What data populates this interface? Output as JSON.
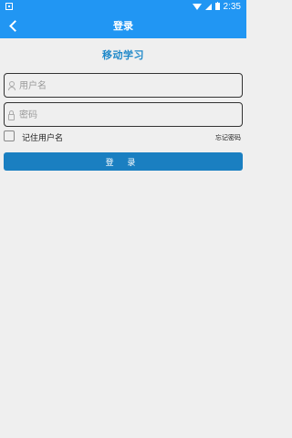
{
  "status_bar": {
    "time": "2:35",
    "icons": [
      "notification-icon",
      "wifi-icon",
      "signal-icon",
      "battery-icon"
    ]
  },
  "app_bar": {
    "title": "登录",
    "back_icon": "chevron-left-icon"
  },
  "heading": "移动学习",
  "form": {
    "username_placeholder": "用户名",
    "password_placeholder": "密码",
    "remember_label": "记住用户名",
    "forgot_label": "忘记密码",
    "login_label": "登 录"
  },
  "colors": {
    "primary": "#2196f3",
    "button": "#1a7fc1",
    "heading": "#1e88c9",
    "background": "#efefef"
  }
}
